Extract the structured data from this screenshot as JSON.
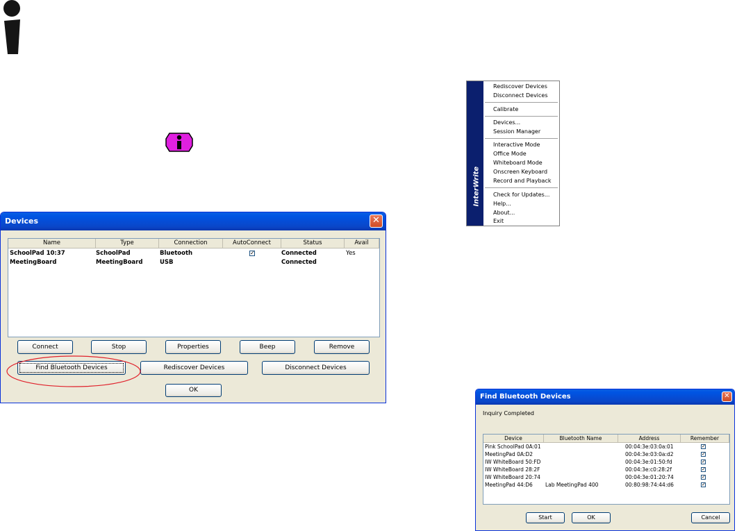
{
  "devices_dialog": {
    "title": "Devices",
    "close_glyph": "✕",
    "columns": [
      "Name",
      "Type",
      "Connection",
      "AutoConnect",
      "Status",
      "Avail"
    ],
    "rows": [
      {
        "name": "SchoolPad 10:37",
        "type": "SchoolPad",
        "connection": "Bluetooth",
        "autoconnect": true,
        "status": "Connected",
        "avail": "Yes"
      },
      {
        "name": "MeetingBoard",
        "type": "MeetingBoard",
        "connection": "USB",
        "autoconnect": false,
        "status": "Connected",
        "avail": ""
      }
    ],
    "buttons": {
      "connect": "Connect",
      "stop": "Stop",
      "properties": "Properties",
      "beep": "Beep",
      "remove": "Remove",
      "find_bluetooth": "Find Bluetooth Devices",
      "rediscover": "Rediscover Devices",
      "disconnect": "Disconnect Devices",
      "ok": "OK"
    },
    "highlight_color": "#e0202a"
  },
  "context_menu": {
    "brand": "InterWrite",
    "items": [
      "Rediscover Devices",
      "Disconnect Devices",
      "Calibrate",
      "Devices...",
      "Session Manager",
      "Interactive Mode",
      "Office Mode",
      "Whiteboard Mode",
      "Onscreen Keyboard",
      "Record and Playback",
      "Check for Updates...",
      "Help...",
      "About...",
      "Exit"
    ]
  },
  "bluetooth_dialog": {
    "title": "Find Bluetooth Devices",
    "close_glyph": "✕",
    "status": "Inquiry Completed",
    "columns": [
      "Device",
      "Bluetooth Name",
      "Address",
      "Remember"
    ],
    "rows": [
      {
        "device": "Pink SchoolPad 0A:01",
        "bt_name": "",
        "address": "00:04:3e:03:0a:01",
        "remember": true
      },
      {
        "device": "MeetingPad 0A:D2",
        "bt_name": "",
        "address": "00:04:3e:03:0a:d2",
        "remember": true
      },
      {
        "device": "IW WhiteBoard 50:FD",
        "bt_name": "",
        "address": "00:04:3e:01:50:fd",
        "remember": true
      },
      {
        "device": "IW WhiteBoard 28:2F",
        "bt_name": "",
        "address": "00:04:3e:c0:28:2f",
        "remember": true
      },
      {
        "device": "IW WhiteBoard 20:74",
        "bt_name": "",
        "address": "00:04:3e:01:20:74",
        "remember": true
      },
      {
        "device": "MeetingPad 44:D6",
        "bt_name": "Lab MeetingPad 400",
        "address": "00:80:98:74:44:d6",
        "remember": true
      }
    ],
    "buttons": {
      "start": "Start",
      "ok": "OK",
      "cancel": "Cancel"
    }
  },
  "icons": {
    "large": "info-person-icon",
    "small": "info-badge-icon",
    "small_color": "#e020e0"
  }
}
